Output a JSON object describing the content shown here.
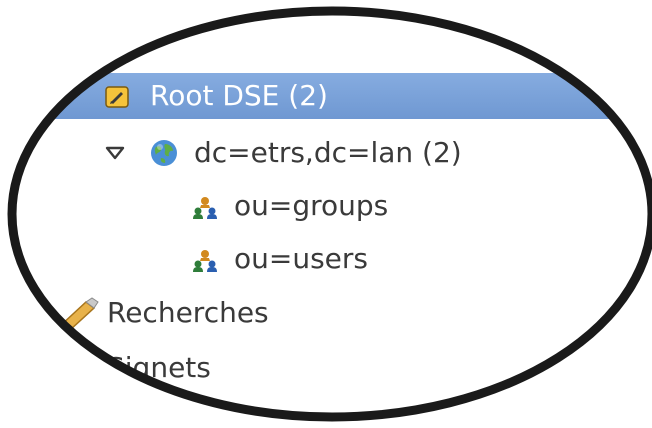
{
  "tree": {
    "root": {
      "label": "Root DSE (2)",
      "icon": "root-dse-icon",
      "selected": true
    },
    "domain": {
      "label": "dc=etrs,dc=lan (2)",
      "icon": "globe-icon",
      "expanded": true
    },
    "children": [
      {
        "label": "ou=groups",
        "icon": "organizational-unit-icon"
      },
      {
        "label": "ou=users",
        "icon": "organizational-unit-icon"
      }
    ],
    "searches": {
      "label": "Recherches",
      "icon": "searches-icon"
    },
    "bookmarks": {
      "label": "Signets",
      "icon": "bookmarks-icon"
    }
  },
  "colors": {
    "selection": "#7aa2d8",
    "text": "#3a3a3a",
    "lens_border": "#1a1a1a"
  }
}
